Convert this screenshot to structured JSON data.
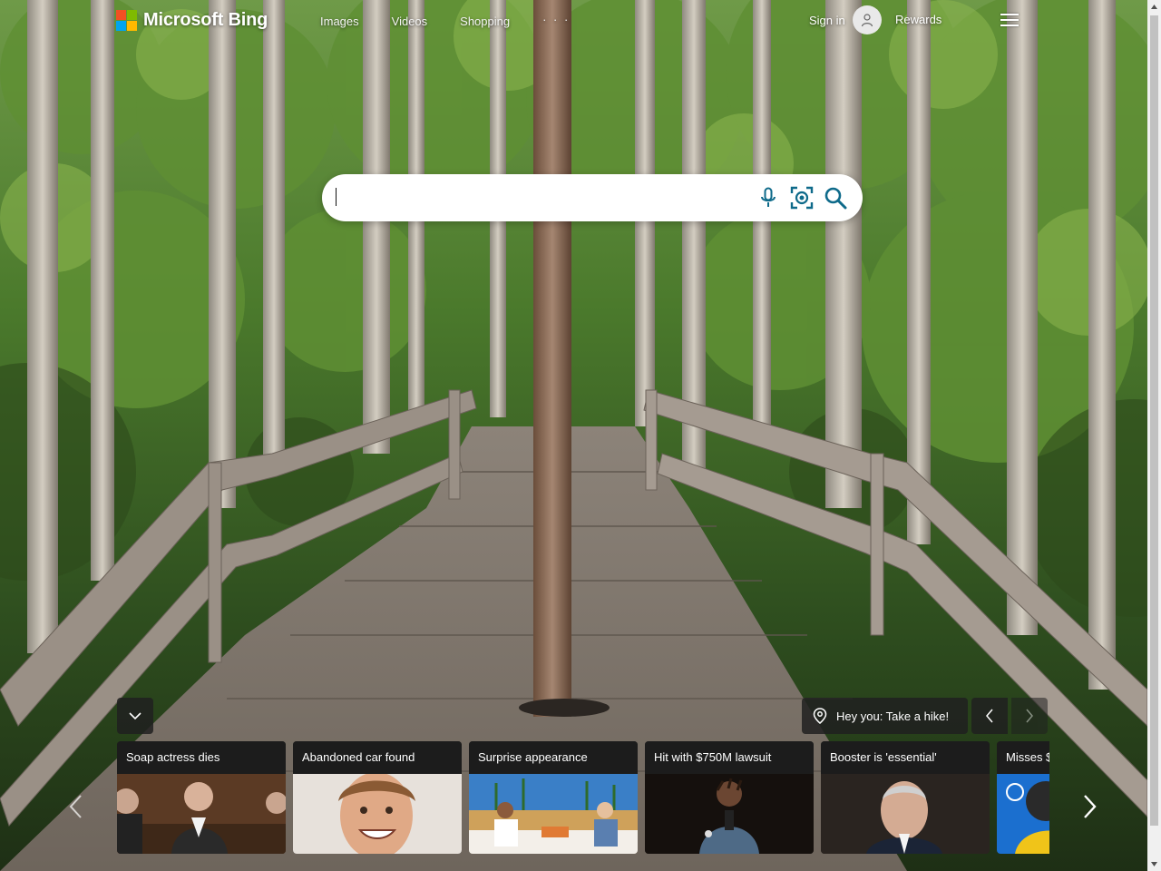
{
  "brand": {
    "name": "Microsoft Bing"
  },
  "nav": {
    "items": [
      "Images",
      "Videos",
      "Shopping"
    ],
    "more_label": "· · ·"
  },
  "account": {
    "signin_label": "Sign in",
    "rewards_label": "Rewards"
  },
  "search": {
    "value": "",
    "placeholder": ""
  },
  "wallpaper": {
    "caption": "Hey you: Take a hike!"
  },
  "news": {
    "cards": [
      {
        "title": "Soap actress dies"
      },
      {
        "title": "Abandoned car found"
      },
      {
        "title": "Surprise appearance"
      },
      {
        "title": "Hit with $750M lawsuit"
      },
      {
        "title": "Booster is 'essential'"
      },
      {
        "title": "Misses $"
      }
    ]
  },
  "icons": {
    "logo": "microsoft-logo",
    "avatar": "person-icon",
    "menu": "hamburger-icon",
    "mic": "microphone-icon",
    "visual_search": "visual-search-icon",
    "search": "magnifier-icon",
    "collapse": "chevron-down-icon",
    "location": "location-pin-icon",
    "prev": "chevron-left-icon",
    "next": "chevron-right-icon"
  },
  "colors": {
    "accent": "#0e6a8a",
    "logo_red": "#f25022",
    "logo_green": "#7fba00",
    "logo_blue": "#00a4ef",
    "logo_yellow": "#ffb900"
  }
}
